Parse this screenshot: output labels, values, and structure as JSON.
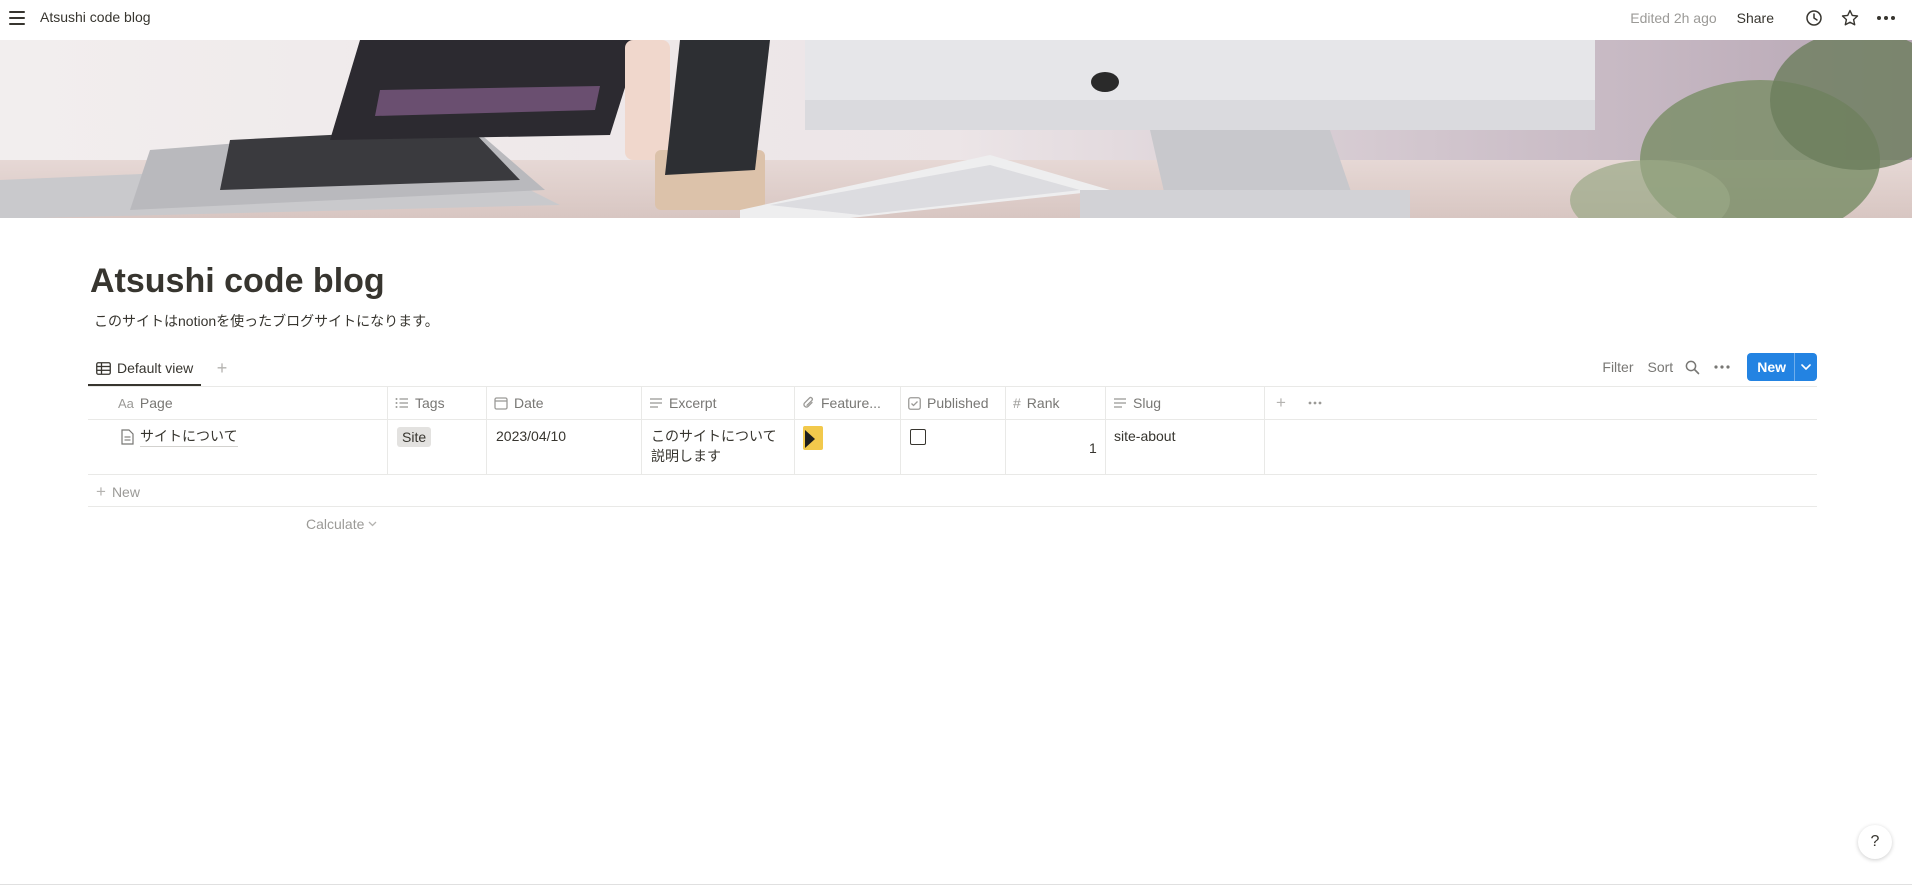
{
  "topbar": {
    "breadcrumb": "Atsushi code blog",
    "edited": "Edited 2h ago",
    "share": "Share"
  },
  "page": {
    "title": "Atsushi code blog",
    "description": "このサイトはnotionを使ったブログサイトになります。"
  },
  "views": {
    "active_tab": "Default view",
    "filter": "Filter",
    "sort": "Sort",
    "new": "New"
  },
  "table": {
    "columns": [
      {
        "icon": "Aa",
        "label": "Page"
      },
      {
        "icon": "list-icon",
        "label": "Tags"
      },
      {
        "icon": "calendar-icon",
        "label": "Date"
      },
      {
        "icon": "text-icon",
        "label": "Excerpt"
      },
      {
        "icon": "paperclip-icon",
        "label": "Feature..."
      },
      {
        "icon": "checkbox-icon",
        "label": "Published"
      },
      {
        "icon": "#",
        "label": "Rank"
      },
      {
        "icon": "text-icon",
        "label": "Slug"
      }
    ],
    "rows": [
      {
        "page": "サイトについて",
        "tags": "Site",
        "date": "2023/04/10",
        "excerpt_line1": "このサイトについて",
        "excerpt_line2": "説明します",
        "published": false,
        "rank": "1",
        "slug": "site-about"
      }
    ],
    "new_row": "New",
    "calculate": "Calculate"
  },
  "help": "?",
  "colors": {
    "accent": "#2383e2",
    "text": "#37352f",
    "muted": "#787774",
    "tag_bg": "#e3e2e0"
  }
}
